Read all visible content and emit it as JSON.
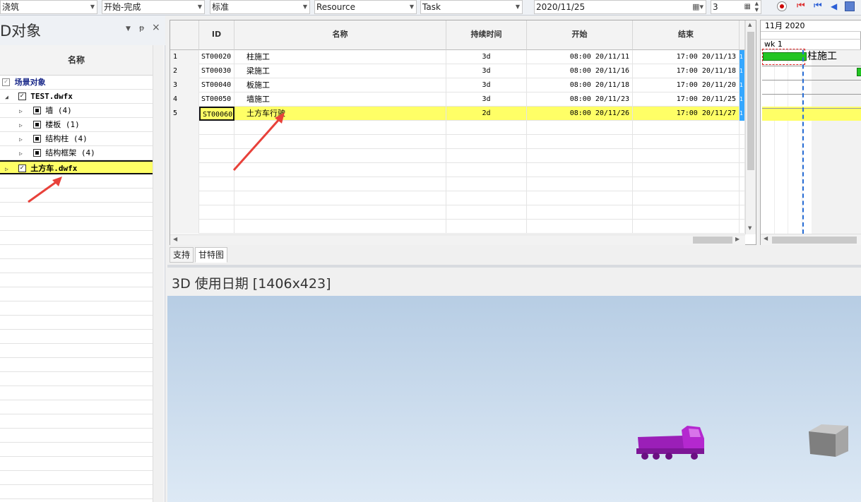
{
  "toolbar": {
    "dropdowns": [
      "浇筑",
      "开始-完成",
      "标准",
      "Resource",
      "Task"
    ],
    "date_value": "2020/11/25",
    "stepper_value": "3"
  },
  "selection_tree": {
    "title": "D对象",
    "column_header": "名称",
    "items": [
      {
        "label": "场景对象"
      },
      {
        "label": "TEST.dwfx"
      },
      {
        "label": "墙 (4)"
      },
      {
        "label": "楼板 (1)"
      },
      {
        "label": "结构柱 (4)"
      },
      {
        "label": "结构框架 (4)"
      },
      {
        "label": "土方车.dwfx"
      }
    ]
  },
  "tasks": {
    "columns": [
      "ID",
      "名称",
      "持续时间",
      "开始",
      "结束"
    ],
    "rows": [
      {
        "n": "1",
        "id": "ST00020",
        "name": "柱施工",
        "duration": "3d",
        "start": "08:00 20/11/11",
        "end": "17:00 20/11/13"
      },
      {
        "n": "2",
        "id": "ST00030",
        "name": "梁施工",
        "duration": "3d",
        "start": "08:00 20/11/16",
        "end": "17:00 20/11/18"
      },
      {
        "n": "3",
        "id": "ST00040",
        "name": "板施工",
        "duration": "3d",
        "start": "08:00 20/11/18",
        "end": "17:00 20/11/20"
      },
      {
        "n": "4",
        "id": "ST00050",
        "name": "墙施工",
        "duration": "3d",
        "start": "08:00 20/11/23",
        "end": "17:00 20/11/25"
      },
      {
        "n": "5",
        "id": "ST00060",
        "name": "土方车行驶",
        "duration": "2d",
        "start": "08:00 20/11/26",
        "end": "17:00 20/11/27"
      }
    ],
    "extra_col_char": "1"
  },
  "gantt": {
    "month_label": "11月 2020",
    "week_label": "wk 1",
    "bar_label": "柱施工"
  },
  "tabs": [
    "支持",
    "甘特图"
  ],
  "view3d": {
    "title": "3D 使用日期  [1406x423]"
  },
  "colors": {
    "highlight": "#ffff66",
    "gantt_bar": "#22c522",
    "annotation_arrow": "#e8413a",
    "truck": "#a020c0"
  }
}
